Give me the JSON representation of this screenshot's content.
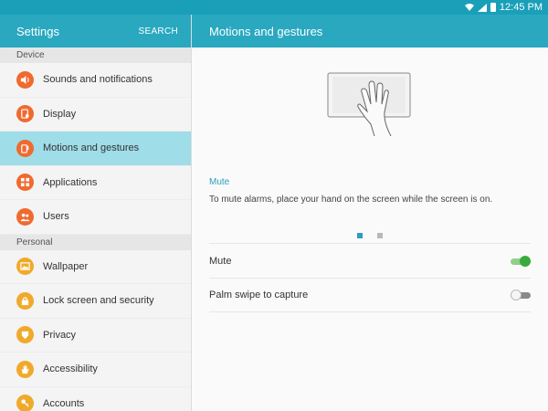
{
  "status_bar": {
    "time": "12:45 PM",
    "icons": [
      "wifi-icon",
      "signal-icon",
      "battery-icon"
    ]
  },
  "left_panel": {
    "title": "Settings",
    "search_label": "SEARCH",
    "sections": [
      {
        "label": "Device",
        "items": [
          {
            "label": "Sounds and notifications",
            "icon": "volume-icon",
            "color": "#f06a2f",
            "selected": false
          },
          {
            "label": "Display",
            "icon": "display-icon",
            "color": "#f06a2f",
            "selected": false
          },
          {
            "label": "Motions and gestures",
            "icon": "motion-icon",
            "color": "#f06a2f",
            "selected": true
          },
          {
            "label": "Applications",
            "icon": "grid-icon",
            "color": "#f06a2f",
            "selected": false
          },
          {
            "label": "Users",
            "icon": "users-icon",
            "color": "#f06a2f",
            "selected": false
          }
        ]
      },
      {
        "label": "Personal",
        "items": [
          {
            "label": "Wallpaper",
            "icon": "image-icon",
            "color": "#f0a92a",
            "selected": false
          },
          {
            "label": "Lock screen and security",
            "icon": "lock-icon",
            "color": "#f0a92a",
            "selected": false
          },
          {
            "label": "Privacy",
            "icon": "privacy-icon",
            "color": "#f0a92a",
            "selected": false
          },
          {
            "label": "Accessibility",
            "icon": "hand-icon",
            "color": "#f0a92a",
            "selected": false
          },
          {
            "label": "Accounts",
            "icon": "key-icon",
            "color": "#f0a92a",
            "selected": false
          }
        ]
      }
    ]
  },
  "right_panel": {
    "title": "Motions and gestures",
    "illustration_icon": "palm-on-screen-icon",
    "feature_title": "Mute",
    "feature_description": "To mute alarms, place your hand on the screen while the screen is on.",
    "pager": {
      "count": 2,
      "active_index": 0
    },
    "settings": [
      {
        "label": "Mute",
        "enabled": true
      },
      {
        "label": "Palm swipe to capture",
        "enabled": false
      }
    ]
  },
  "colors": {
    "accent": "#29a8c0",
    "selected_row": "#9fdde8",
    "toggle_on": "#3aaa3a",
    "device_icon": "#f06a2f",
    "personal_icon": "#f0a92a"
  }
}
